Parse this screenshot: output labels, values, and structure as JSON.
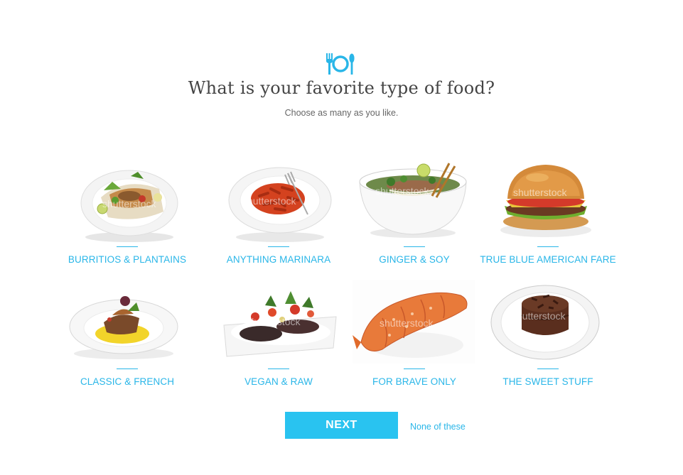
{
  "header": {
    "icon": "fork-plate-spoon-icon",
    "title": "What is your favorite type of food?",
    "subtitle": "Choose as many as you like."
  },
  "options": [
    {
      "label": "BURRITIOS & PLANTAINS",
      "image": "burrito-plate"
    },
    {
      "label": "ANYTHING MARINARA",
      "image": "penne-marinara-plate"
    },
    {
      "label": "GINGER & SOY",
      "image": "pho-bowl"
    },
    {
      "label": "TRUE BLUE AMERICAN FARE",
      "image": "burger"
    },
    {
      "label": "CLASSIC & FRENCH",
      "image": "french-dish-plate"
    },
    {
      "label": "VEGAN & RAW",
      "image": "vegan-rolls-plate"
    },
    {
      "label": "FOR BRAVE ONLY",
      "image": "lobster-tail"
    },
    {
      "label": "THE SWEET STUFF",
      "image": "chocolate-cake"
    }
  ],
  "actions": {
    "next_label": "NEXT",
    "none_label": "None of these"
  },
  "watermark": "shutterstock",
  "colors": {
    "accent": "#29b6e8",
    "button": "#29c3f0",
    "title": "#444444"
  }
}
